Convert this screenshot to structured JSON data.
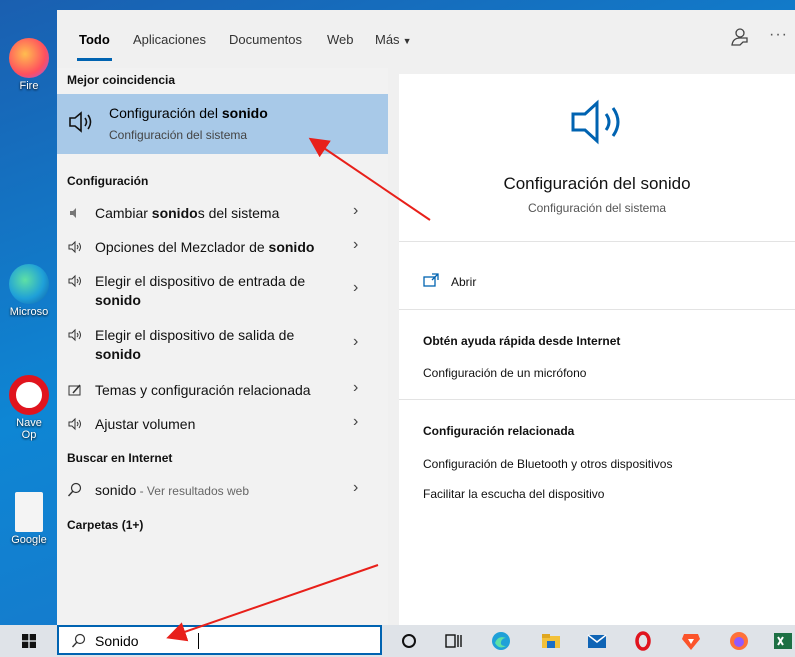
{
  "desktop_icons": [
    {
      "label": "Fire"
    },
    {
      "label": "Microso"
    },
    {
      "label": "Nave"
    },
    {
      "label": "Op"
    },
    {
      "label": "Google"
    }
  ],
  "tabs": [
    {
      "label": "Todo"
    },
    {
      "label": "Aplicaciones"
    },
    {
      "label": "Documentos"
    },
    {
      "label": "Web"
    },
    {
      "label": "Más"
    }
  ],
  "left": {
    "best_match_heading": "Mejor coincidencia",
    "best_match": {
      "title_pre": "Configuración del ",
      "title_bold": "sonido",
      "subtitle": "Configuración del sistema"
    },
    "config_heading": "Configuración",
    "config_items": [
      {
        "pre": "Cambiar ",
        "bold": "sonido",
        "post": "s del sistema",
        "pre2": "",
        "post2": ""
      },
      {
        "pre": "Opciones del Mezclador de ",
        "bold": "sonido",
        "post": ""
      },
      {
        "line1": "Elegir el dispositivo de entrada de",
        "line2": "sonido"
      },
      {
        "line1": "Elegir el dispositivo de salida de",
        "line2": "sonido"
      },
      {
        "text": "Temas y configuración relacionada"
      },
      {
        "text": "Ajustar volumen"
      }
    ],
    "web_heading": "Buscar en Internet",
    "web_item": {
      "query": "sonido",
      "suffix": " - Ver resultados web"
    },
    "folders_heading": "Carpetas (1+)"
  },
  "right": {
    "title": "Configuración del sonido",
    "subtitle": "Configuración del sistema",
    "open_label": "Abrir",
    "help_heading": "Obtén ayuda rápida desde Internet",
    "help_links": [
      "Configuración de un micrófono"
    ],
    "related_heading": "Configuración relacionada",
    "related_links": [
      "Configuración de Bluetooth y otros dispositivos",
      "Facilitar la escucha del dispositivo"
    ]
  },
  "taskbar": {
    "search_value": "Sonido",
    "apps": [
      "cortana-icon",
      "task-view-icon",
      "edge-icon",
      "file-explorer-icon",
      "mail-icon",
      "opera-icon",
      "brave-icon",
      "firefox-icon",
      "excel-icon"
    ]
  },
  "colors": {
    "accent": "#0063b1",
    "selected": "#a8c9e8",
    "annotation": "#e8201a"
  }
}
